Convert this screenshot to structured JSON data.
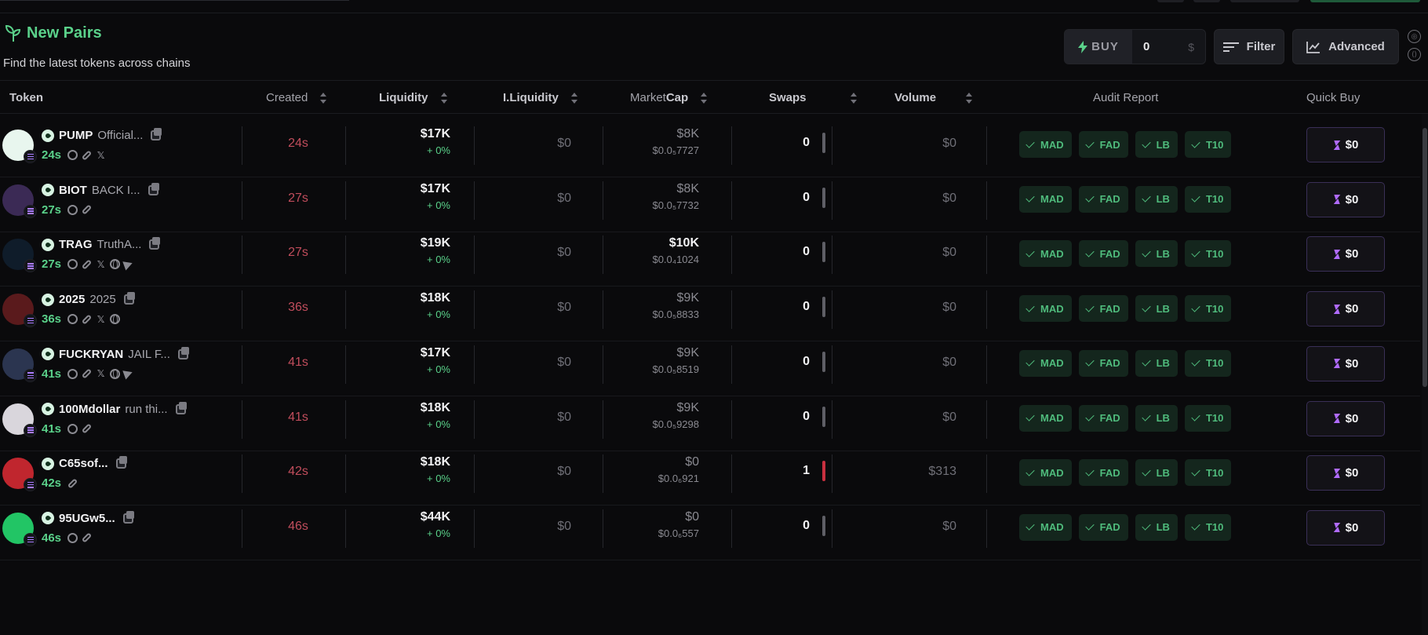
{
  "header": {
    "title": "New Pairs",
    "subtitle": "Find the latest tokens across chains",
    "buy_label": "BUY",
    "buy_amount": "0",
    "buy_currency": "$",
    "filter_label": "Filter",
    "advanced_label": "Advanced"
  },
  "columns": {
    "token": "Token",
    "created": "Created",
    "liquidity": "Liquidity",
    "initial_liquidity": "I.Liquidity",
    "marketcap_prefix": "Market",
    "marketcap_suffix": "Cap",
    "swaps": "Swaps",
    "volume": "Volume",
    "audit": "Audit Report",
    "quick_buy": "Quick Buy"
  },
  "audit_labels": [
    "MAD",
    "FAD",
    "LB",
    "T10"
  ],
  "quick_buy_label": "$0",
  "colors": {
    "accent_green": "#5ad18a",
    "created_red": "#c14d5c",
    "audit_bg": "#14261d",
    "quick_buy_border": "#3a2f57",
    "bolt_purple": "#b06bff"
  },
  "rows": [
    {
      "symbol": "PUMP",
      "name": "Official...",
      "age": "24s",
      "socials": [
        "search-icon",
        "link-icon",
        "x-icon"
      ],
      "created": "24s",
      "liquidity": "$17K",
      "liq_change": "+ 0%",
      "i_liquidity": "$0",
      "mcap": "$8K",
      "mcap_highlight": false,
      "price": "$0.0₅7727",
      "swaps": "0",
      "swap_bar": "neutral",
      "volume": "$0",
      "avatar_color": "#e8f6ee"
    },
    {
      "symbol": "BIOT",
      "name": "BACK I...",
      "age": "27s",
      "socials": [
        "search-icon",
        "link-icon"
      ],
      "created": "27s",
      "liquidity": "$17K",
      "liq_change": "+ 0%",
      "i_liquidity": "$0",
      "mcap": "$8K",
      "mcap_highlight": false,
      "price": "$0.0₅7732",
      "swaps": "0",
      "swap_bar": "neutral",
      "volume": "$0",
      "avatar_color": "#3b2a55"
    },
    {
      "symbol": "TRAG",
      "name": "TruthA...",
      "age": "27s",
      "socials": [
        "search-icon",
        "link-icon",
        "x-icon",
        "globe-icon",
        "telegram-icon"
      ],
      "created": "27s",
      "liquidity": "$19K",
      "liq_change": "+ 0%",
      "i_liquidity": "$0",
      "mcap": "$10K",
      "mcap_highlight": true,
      "price": "$0.0₄1024",
      "swaps": "0",
      "swap_bar": "neutral",
      "volume": "$0",
      "avatar_color": "#0f1c2a"
    },
    {
      "symbol": "2025",
      "name": "2025",
      "age": "36s",
      "socials": [
        "search-icon",
        "link-icon",
        "x-icon",
        "globe-icon"
      ],
      "created": "36s",
      "liquidity": "$18K",
      "liq_change": "+ 0%",
      "i_liquidity": "$0",
      "mcap": "$9K",
      "mcap_highlight": false,
      "price": "$0.0₅8833",
      "swaps": "0",
      "swap_bar": "neutral",
      "volume": "$0",
      "avatar_color": "#5a1a1c"
    },
    {
      "symbol": "FUCKRYAN",
      "name": "JAIL F...",
      "age": "41s",
      "socials": [
        "search-icon",
        "link-icon",
        "x-icon",
        "globe-icon",
        "telegram-icon"
      ],
      "created": "41s",
      "liquidity": "$17K",
      "liq_change": "+ 0%",
      "i_liquidity": "$0",
      "mcap": "$9K",
      "mcap_highlight": false,
      "price": "$0.0₅8519",
      "swaps": "0",
      "swap_bar": "neutral",
      "volume": "$0",
      "avatar_color": "#2b3550"
    },
    {
      "symbol": "100Mdollar",
      "name": "run thi...",
      "age": "41s",
      "socials": [
        "search-icon",
        "link-icon"
      ],
      "created": "41s",
      "liquidity": "$18K",
      "liq_change": "+ 0%",
      "i_liquidity": "$0",
      "mcap": "$9K",
      "mcap_highlight": false,
      "price": "$0.0₅9298",
      "swaps": "0",
      "swap_bar": "neutral",
      "volume": "$0",
      "avatar_color": "#d9d6dc"
    },
    {
      "symbol": "C65sof...",
      "name": "",
      "age": "42s",
      "socials": [
        "link-icon"
      ],
      "created": "42s",
      "liquidity": "$18K",
      "liq_change": "+ 0%",
      "i_liquidity": "$0",
      "mcap": "$0",
      "mcap_highlight": false,
      "price": "$0.0₆921",
      "swaps": "1",
      "swap_bar": "red",
      "volume": "$313",
      "avatar_color": "#c0262e"
    },
    {
      "symbol": "95UGw5...",
      "name": "",
      "age": "46s",
      "socials": [
        "search-icon",
        "link-icon"
      ],
      "created": "46s",
      "liquidity": "$44K",
      "liq_change": "+ 0%",
      "i_liquidity": "$0",
      "mcap": "$0",
      "mcap_highlight": false,
      "price": "$0.0₆557",
      "swaps": "0",
      "swap_bar": "neutral",
      "volume": "$0",
      "avatar_color": "#22c565"
    }
  ]
}
